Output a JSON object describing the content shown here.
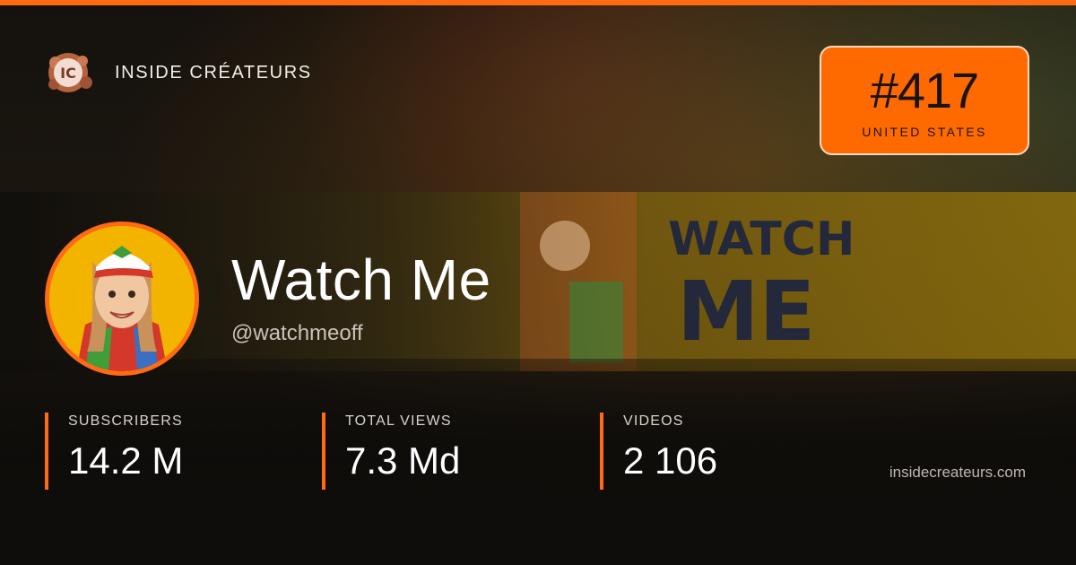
{
  "brand": {
    "name": "INSIDE CRÉATEURS",
    "logo_text": "IC",
    "logo_icon": "ic-logo-icon"
  },
  "rank": {
    "number": "#417",
    "country": "UNITED STATES"
  },
  "banner": {
    "title_line1": "WATCH",
    "title_line2": "ME"
  },
  "channel": {
    "name": "Watch Me",
    "handle": "@watchmeoff"
  },
  "stats": [
    {
      "label": "SUBSCRIBERS",
      "value": "14.2 M"
    },
    {
      "label": "TOTAL VIEWS",
      "value": "7.3 Md"
    },
    {
      "label": "VIDEOS",
      "value": "2 106"
    }
  ],
  "site": "insidecreateurs.com",
  "colors": {
    "accent": "#ff6a13",
    "badge": "#ff6a00",
    "banner_yellow": "#f3b400",
    "banner_text": "#1c2340"
  }
}
